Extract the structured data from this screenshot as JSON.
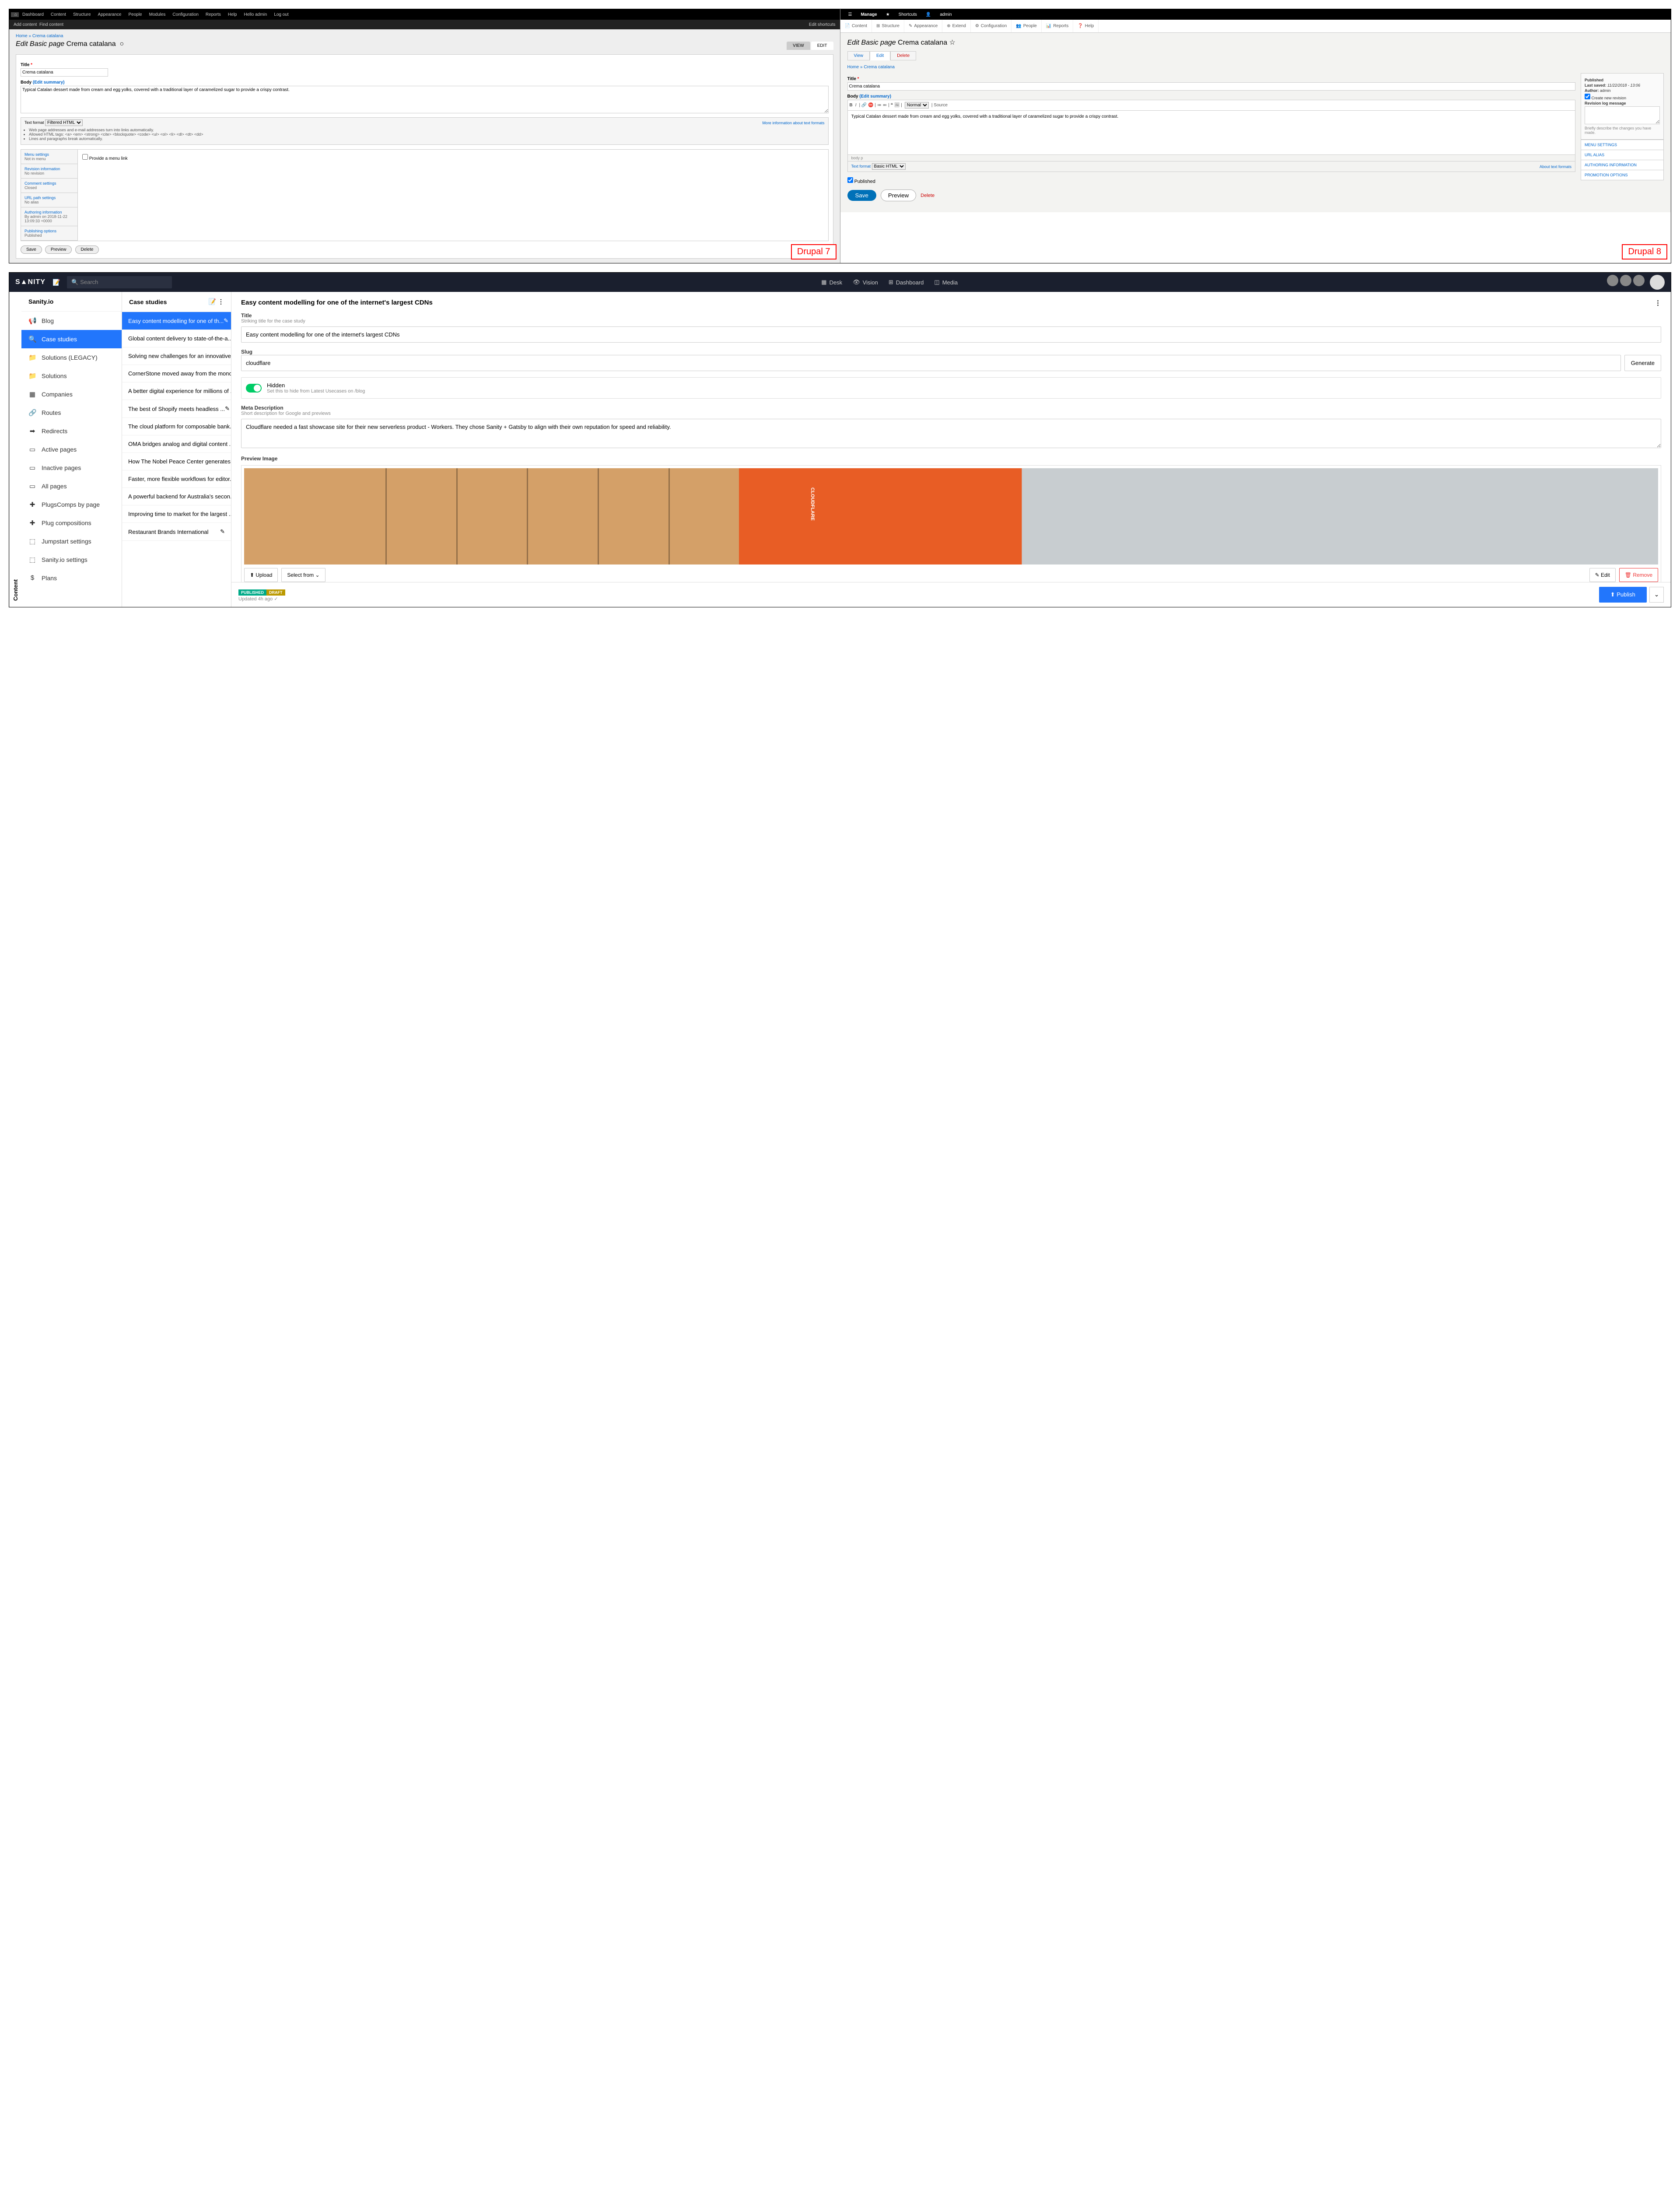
{
  "d7": {
    "menu": [
      "Dashboard",
      "Content",
      "Structure",
      "Appearance",
      "People",
      "Modules",
      "Configuration",
      "Reports",
      "Help",
      "Hello admin",
      "Log out"
    ],
    "sub": {
      "left": [
        "Add content",
        "Find content"
      ],
      "right": "Edit shortcuts"
    },
    "crumb": [
      "Home",
      "Crema catalana"
    ],
    "h1_prefix": "Edit Basic page",
    "h1_title": "Crema catalana",
    "tabs": [
      "VIEW",
      "EDIT"
    ],
    "title_label": "Title",
    "title_value": "Crema catalana",
    "body_label": "Body",
    "edit_summary": "(Edit summary)",
    "body_value": "Typical Catalan dessert made from cream and egg yolks, covered with a traditional layer of caramelized sugar to provide a crispy contrast.",
    "text_format_label": "Text format",
    "text_format_value": "Filtered HTML",
    "more_info": "More information about text formats",
    "tf_tips": [
      "Web page addresses and e-mail addresses turn into links automatically.",
      "Allowed HTML tags: <a> <em> <strong> <cite> <blockquote> <code> <ul> <ol> <li> <dl> <dt> <dd>",
      "Lines and paragraphs break automatically."
    ],
    "vtabs": [
      {
        "t": "Menu settings",
        "s": "Not in menu"
      },
      {
        "t": "Revision information",
        "s": "No revision"
      },
      {
        "t": "Comment settings",
        "s": "Closed"
      },
      {
        "t": "URL path settings",
        "s": "No alias"
      },
      {
        "t": "Authoring information",
        "s": "By admin on 2018-11-22 13:09:33 +0000"
      },
      {
        "t": "Publishing options",
        "s": "Published"
      }
    ],
    "menu_checkbox": "Provide a menu link",
    "btns": [
      "Save",
      "Preview",
      "Delete"
    ],
    "label": "Drupal 7"
  },
  "d8": {
    "mbar": [
      "☰",
      "Manage",
      "★",
      "Shortcuts",
      "👤",
      "admin"
    ],
    "tabs2": [
      "Content",
      "Structure",
      "Appearance",
      "Extend",
      "Configuration",
      "People",
      "Reports",
      "Help"
    ],
    "h1_prefix": "Edit Basic page",
    "h1_title": "Crema catalana",
    "local_tabs": [
      "View",
      "Edit",
      "Delete"
    ],
    "crumb": [
      "Home",
      "Crema catalana"
    ],
    "title_label": "Title",
    "title_value": "Crema catalana",
    "body_label": "Body",
    "edit_summary": "(Edit summary)",
    "body_value": "Typical Catalan dessert made from cream and egg yolks, covered with a traditional layer of caramelized sugar to provide a crispy contrast.",
    "status_path": "body p",
    "text_format": "Text format",
    "text_format_value": "Basic HTML",
    "about": "About text formats",
    "published_chk": "Published",
    "side": {
      "title": "Published",
      "last_saved_label": "Last saved:",
      "last_saved": "11/22/2018 - 13:06",
      "author_label": "Author:",
      "author": "admin",
      "new_rev": "Create new revision",
      "rev_log": "Revision log message",
      "help": "Briefly describe the changes you have made.",
      "links": [
        "MENU SETTINGS",
        "URL ALIAS",
        "AUTHORING INFORMATION",
        "PROMOTION OPTIONS"
      ]
    },
    "btns": {
      "save": "Save",
      "preview": "Preview",
      "delete": "Delete"
    },
    "label": "Drupal 8"
  },
  "sanity": {
    "logo": "S▲NITY",
    "search_ph": "Search",
    "nav": [
      "Desk",
      "Vision",
      "Dashboard",
      "Media"
    ],
    "vbar": "Content",
    "col1": {
      "title": "Sanity.io",
      "items": [
        {
          "ico": "📢",
          "t": "Blog"
        },
        {
          "ico": "🔍",
          "t": "Case studies",
          "sel": true
        },
        {
          "ico": "📁",
          "t": "Solutions (LEGACY)"
        },
        {
          "ico": "📁",
          "t": "Solutions"
        },
        {
          "ico": "▦",
          "t": "Companies"
        },
        {
          "ico": "🔗",
          "t": "Routes"
        },
        {
          "ico": "➡",
          "t": "Redirects"
        },
        {
          "ico": "▭",
          "t": "Active pages"
        },
        {
          "ico": "▭",
          "t": "Inactive pages"
        },
        {
          "ico": "▭",
          "t": "All pages"
        },
        {
          "ico": "✚",
          "t": "PlugsComps by page"
        },
        {
          "ico": "✚",
          "t": "Plug compositions"
        },
        {
          "ico": "⬚",
          "t": "Jumpstart settings"
        },
        {
          "ico": "⬚",
          "t": "Sanity.io settings"
        },
        {
          "ico": "$",
          "t": "Plans"
        }
      ]
    },
    "col2": {
      "title": "Case studies",
      "items": [
        "Easy content modelling for one of th...",
        "Global content delivery to state-of-the-a...",
        "Solving new challenges for an innovative ...",
        "CornerStone moved away from the mono...",
        "A better digital experience for millions of ...",
        "The best of Shopify meets headless ...",
        "The cloud platform for composable bank...",
        "OMA bridges analog and digital content ...",
        "How The Nobel Peace Center generates ...",
        "Faster, more flexible workflows for editor...",
        "A powerful backend for Australia's secon...",
        "Improving time to market for the largest ...",
        "Restaurant Brands International"
      ]
    },
    "col3": {
      "title": "Easy content modelling for one of the internet's largest CDNs",
      "title_label": "Title",
      "title_help": "Striking title for the case study",
      "title_value": "Easy content modelling for one of the internet's largest CDNs",
      "slug_label": "Slug",
      "slug_value": "cloudflare",
      "gen": "Generate",
      "hidden_label": "Hidden",
      "hidden_help": "Set this to hide from Latest Usecases on /blog",
      "meta_label": "Meta Description",
      "meta_help": "Short description for Google and previews",
      "meta_value": "Cloudflare needed a fast showcase site for their new serverless product - Workers. They chose Sanity + Gatsby to align with their own reputation for speed and reliability.",
      "preview_label": "Preview Image",
      "img_btns": {
        "upload": "Upload",
        "select": "Select from",
        "edit": "Edit",
        "remove": "Remove"
      },
      "pub": {
        "published": "PUBLISHED",
        "draft": "DRAFT",
        "updated": "Updated 4h ago ✓",
        "btn": "Publish"
      }
    }
  }
}
